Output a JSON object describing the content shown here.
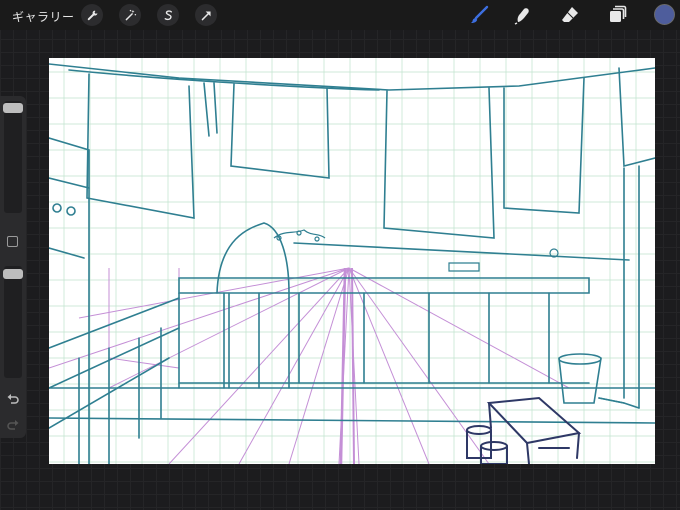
{
  "app": {
    "gallery_label": "ギャラリー"
  },
  "toolbar_left": [
    {
      "name": "actions-wrench-icon"
    },
    {
      "name": "adjustments-wand-icon"
    },
    {
      "name": "selection-s-icon"
    },
    {
      "name": "transform-arrow-icon"
    }
  ],
  "toolbar_right": [
    {
      "name": "brush-icon",
      "active": true
    },
    {
      "name": "smudge-icon"
    },
    {
      "name": "eraser-icon"
    },
    {
      "name": "layers-icon"
    }
  ],
  "current_color": "#4e5d9c",
  "sidebar": {
    "brush_size": 0.95,
    "opacity": 0.95
  },
  "colors": {
    "line_teal": "#2f7f91",
    "line_purple": "#c48fd6",
    "line_green": "#9fd4b5",
    "line_navy": "#2e3866",
    "accent_brush": "#3d6fe0"
  }
}
